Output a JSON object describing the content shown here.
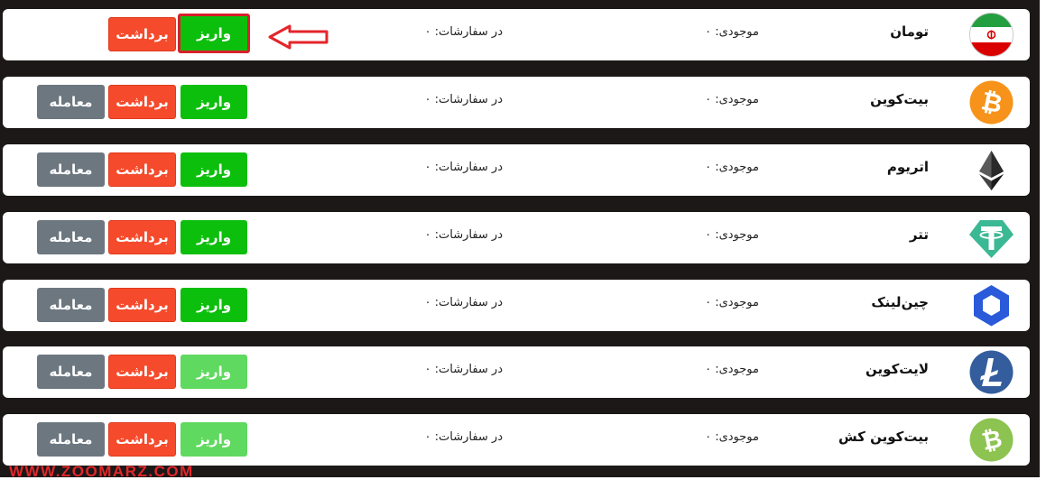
{
  "labels": {
    "balance": "موجودی: ۰",
    "orders": "در سفارشات: ۰",
    "deposit": "واریز",
    "withdraw": "برداشت",
    "trade": "معامله"
  },
  "assets": [
    {
      "name": "تومان",
      "icon": "iran-flag-icon",
      "deposit_faded": false,
      "has_trade": false,
      "highlighted": true
    },
    {
      "name": "بیت‌کوین",
      "icon": "bitcoin-icon",
      "deposit_faded": false,
      "has_trade": true,
      "highlighted": false
    },
    {
      "name": "اتریوم",
      "icon": "ethereum-icon",
      "deposit_faded": false,
      "has_trade": true,
      "highlighted": false
    },
    {
      "name": "تتر",
      "icon": "tether-icon",
      "deposit_faded": false,
      "has_trade": true,
      "highlighted": false
    },
    {
      "name": "چین‌لینک",
      "icon": "chainlink-icon",
      "deposit_faded": false,
      "has_trade": true,
      "highlighted": false
    },
    {
      "name": "لایت‌کوین",
      "icon": "litecoin-icon",
      "deposit_faded": true,
      "has_trade": true,
      "highlighted": false
    },
    {
      "name": "بیت‌کوین کش",
      "icon": "bitcoin-cash-icon",
      "deposit_faded": true,
      "has_trade": true,
      "highlighted": false
    }
  ],
  "watermark": "WWW.ZOOMARZ.COM",
  "colors": {
    "deposit": "#0dbf0d",
    "deposit_faded": "#5fd95f",
    "withdraw": "#f54b2c",
    "trade": "#6c7780",
    "highlight": "#d8202a",
    "background": "#1c1818"
  }
}
